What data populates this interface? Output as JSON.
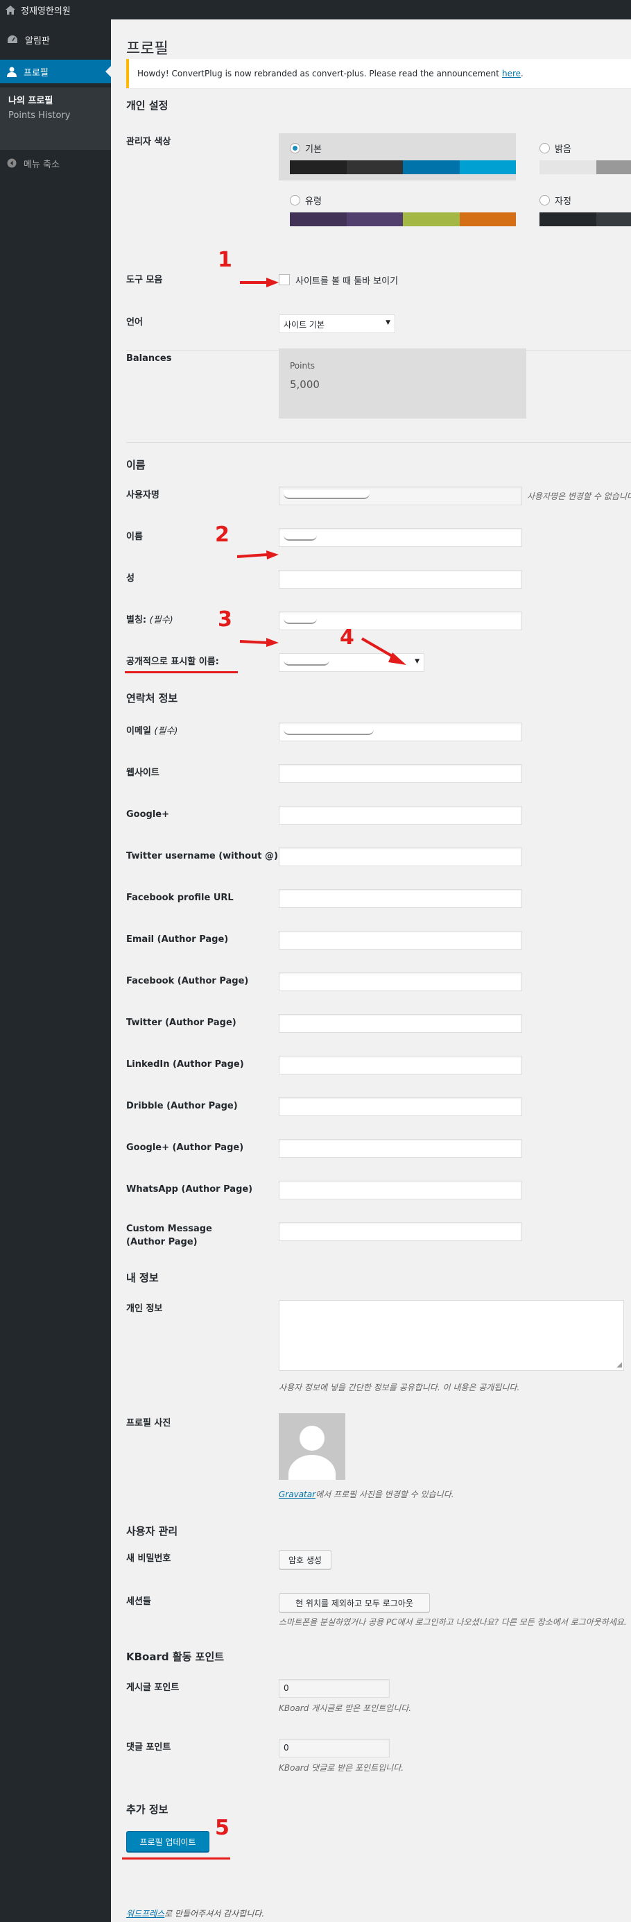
{
  "admin_bar": {
    "site_name": "정재영한의원"
  },
  "sidebar": {
    "dashboard": "알림판",
    "profile": "프로필",
    "my_profile": "나의 프로필",
    "points_history": "Points History",
    "collapse": "메뉴 축소"
  },
  "page": {
    "title": "프로필",
    "notice_text": "Howdy! ConvertPlug is now rebranded as convert-plus. Please read the announcement",
    "notice_link": "here",
    "notice_period": "."
  },
  "personal": {
    "heading": "개인 설정",
    "admin_color_label": "관리자 색상",
    "color_schemes": [
      {
        "name": "기본",
        "selected": true,
        "colors": [
          "#222222",
          "#333333",
          "#0073aa",
          "#00a0d2"
        ]
      },
      {
        "name": "밝음",
        "selected": false,
        "colors": [
          "#e5e5e5",
          "#999999",
          "#d64e07",
          "#04a4cc"
        ]
      },
      {
        "name": "유령",
        "selected": false,
        "colors": [
          "#413256",
          "#523f6d",
          "#a3b745",
          "#d46f15"
        ]
      },
      {
        "name": "자정",
        "selected": false,
        "colors": [
          "#25282b",
          "#363b3f",
          "#69a8bb",
          "#e14d43"
        ]
      }
    ],
    "toolbar_label": "도구 모음",
    "toolbar_checkbox": "사이트를 볼 때 툴바 보이기",
    "language_label": "언어",
    "language_value": "사이트 기본",
    "balances_label": "Balances",
    "points_title": "Points",
    "points_value": "5,000"
  },
  "name": {
    "heading": "이름",
    "username_label": "사용자명",
    "username_desc": "사용자명은 변경할 수 없습니다.",
    "first_name_label": "이름",
    "last_name_label": "성",
    "nickname_label": "별칭:",
    "nickname_required": "(필수)",
    "display_name_label": "공개적으로 표시할 이름:"
  },
  "contact": {
    "heading": "연락처 정보",
    "email_label": "이메일",
    "email_required": "(필수)",
    "fields": [
      "웹사이트",
      "Google+",
      "Twitter username (without @)",
      "Facebook profile URL",
      "Email (Author Page)",
      "Facebook (Author Page)",
      "Twitter (Author Page)",
      "LinkedIn (Author Page)",
      "Dribble (Author Page)",
      "Google+ (Author Page)",
      "WhatsApp (Author Page)",
      "Custom Message (Author Page)"
    ]
  },
  "about": {
    "heading": "내 정보",
    "bio_label": "개인 정보",
    "bio_desc": "사용자 정보에 넣을 간단한 정보를 공유합니다. 이 내용은 공개됩니다.",
    "picture_label": "프로필 사진",
    "gravatar_link": "Gravatar",
    "gravatar_desc": "에서 프로필 사진을 변경할 수 있습니다."
  },
  "account": {
    "heading": "사용자 관리",
    "new_password_label": "새 비밀번호",
    "generate_password_button": "암호 생성",
    "sessions_label": "세션들",
    "logout_button": "현 위치를 제외하고 모두 로그아웃",
    "sessions_desc": "스마트폰을 분실하였거나 공용 PC에서 로그인하고 나오셨나요? 다른 모든 장소에서 로그아웃하세요."
  },
  "kboard": {
    "heading": "KBoard 활동 포인트",
    "post_points_label": "게시글 포인트",
    "post_points_value": "0",
    "post_points_desc": "KBoard 게시글로 받은 포인트입니다.",
    "comment_points_label": "댓글 포인트",
    "comment_points_value": "0",
    "comment_points_desc": "KBoard 댓글로 받은 포인트입니다."
  },
  "extra": {
    "heading": "추가 정보",
    "update_button": "프로필 업데이트"
  },
  "footer": {
    "link": "워드프레스",
    "text": "로 만들어주셔서 감사합니다."
  },
  "annotations": [
    "1",
    "2",
    "3",
    "4",
    "5"
  ]
}
